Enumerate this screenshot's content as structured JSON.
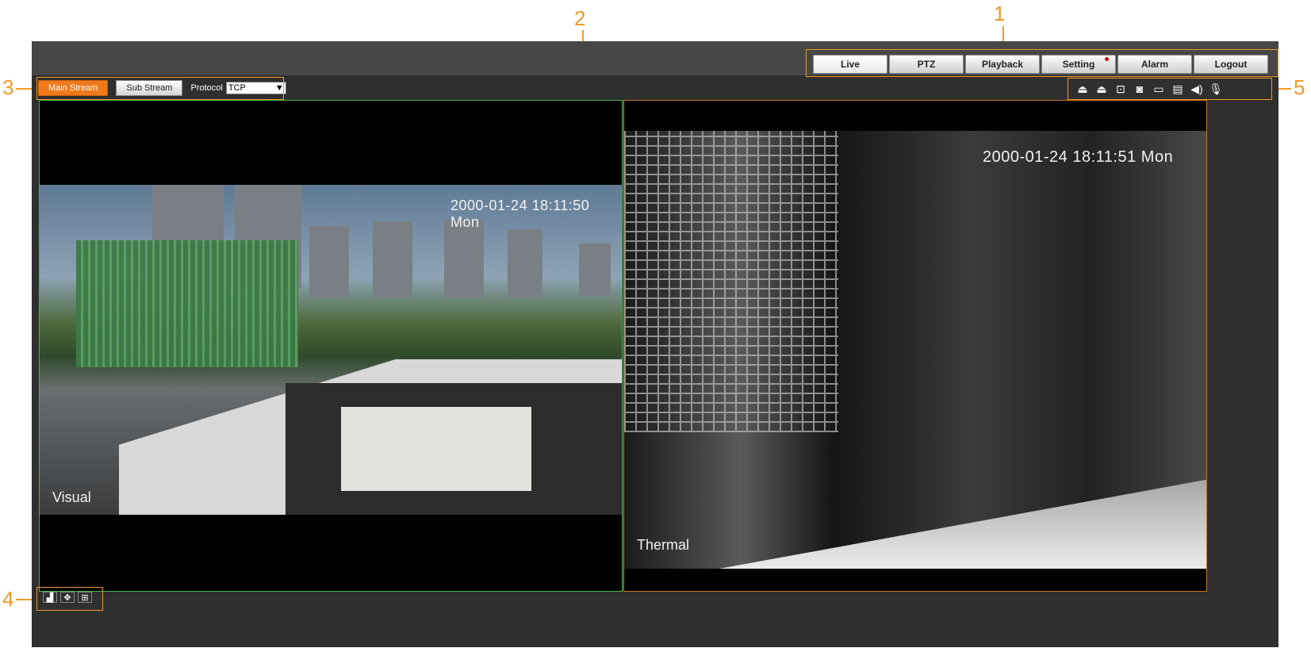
{
  "nav": {
    "items": [
      {
        "label": "Live",
        "active": true
      },
      {
        "label": "PTZ"
      },
      {
        "label": "Playback"
      },
      {
        "label": "Setting",
        "badge": true
      },
      {
        "label": "Alarm"
      },
      {
        "label": "Logout"
      }
    ]
  },
  "stream": {
    "main_label": "Main Stream",
    "sub_label": "Sub Stream",
    "protocol_label": "Protocol",
    "protocol_value": "TCP"
  },
  "toolbar_icons": [
    "alarm-out-icon",
    "alarm-out-icon-2",
    "zoom-icon",
    "snapshot-icon",
    "record-icon",
    "triple-snapshot-icon",
    "audio-icon",
    "talk-icon"
  ],
  "video1": {
    "timestamp": "2000-01-24 18:11:50 Mon",
    "channel_label": "Visual"
  },
  "video2": {
    "timestamp": "2000-01-24 18:11:51 Mon",
    "channel_label": "Thermal"
  },
  "bottom_icons": [
    "fit-window-icon",
    "ptz-control-icon",
    "fullscreen-icon"
  ],
  "annotations": [
    "1",
    "2",
    "3",
    "4",
    "5"
  ],
  "colors": {
    "accent": "#f07a1b",
    "annotation": "#f09a28",
    "visual_border": "#48b448"
  }
}
